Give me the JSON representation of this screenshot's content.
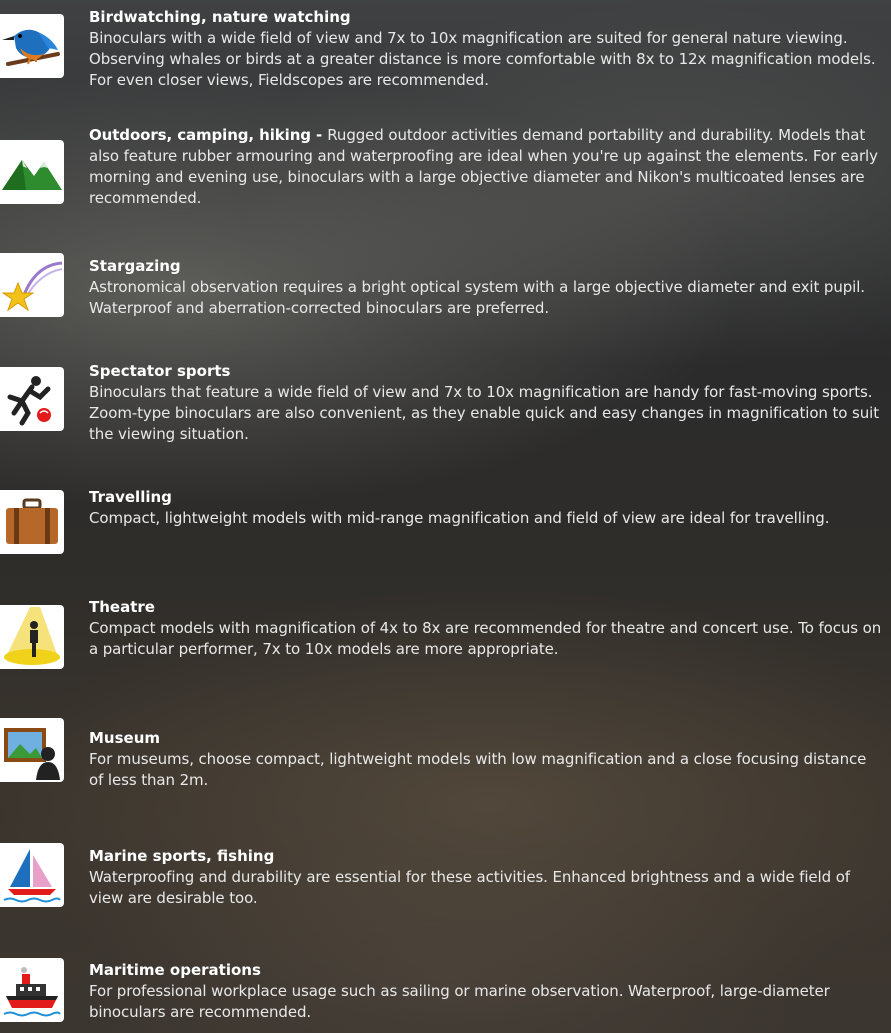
{
  "items": [
    {
      "title": "Birdwatching, nature watching",
      "desc": "Binoculars with a wide field of view and 7x to 10x magnification are suited for general nature viewing. Observing whales or birds at a greater distance is more comfortable with 8x to 12x magnification models. For even closer views, Fieldscopes are recommended.",
      "icon": "kingfisher-icon"
    },
    {
      "title": "Outdoors, camping, hiking - ",
      "desc": "Rugged outdoor activities demand portability and durability. Models that also feature rubber armouring  and waterproofing are ideal when you're up against the elements. For early morning and evening use, binoculars with a large objective diameter and Nikon's multicoated lenses are recommended.",
      "icon": "mountains-icon"
    },
    {
      "title": "Stargazing",
      "desc": "Astronomical observation requires a bright optical system with a large objective diameter and exit pupil. Waterproof and aberration-corrected binoculars are preferred.",
      "icon": "shooting-star-icon"
    },
    {
      "title": "Spectator sports",
      "desc": "Binoculars that feature a wide field of view and 7x to 10x magnification are handy for fast-moving sports. Zoom-type binoculars are also convenient, as they enable quick and easy changes in magnification to suit the viewing situation.",
      "icon": "soccer-player-icon"
    },
    {
      "title": "Travelling",
      "desc": "Compact, lightweight models with mid-range magnification and field of view are ideal for travelling.",
      "icon": "suitcase-icon"
    },
    {
      "title": "Theatre",
      "desc": "Compact models with magnification of 4x to 8x are recommended for theatre and concert use. To focus on a particular performer, 7x to 10x models are more appropriate.",
      "icon": "spotlight-performer-icon"
    },
    {
      "title": "Museum",
      "desc": "For museums, choose compact, lightweight models with low magnification and a close focusing distance of less than 2m.",
      "icon": "painting-viewer-icon"
    },
    {
      "title": "Marine sports, fishing",
      "desc": "Waterproofing and durability are essential for these activities. Enhanced brightness and a wide field of view are desirable too.",
      "icon": "sailboat-icon"
    },
    {
      "title": "Maritime operations",
      "desc": "For professional workplace usage such as sailing or marine observation. Waterproof, large-diameter binoculars are recommended.",
      "icon": "ship-icon"
    }
  ]
}
